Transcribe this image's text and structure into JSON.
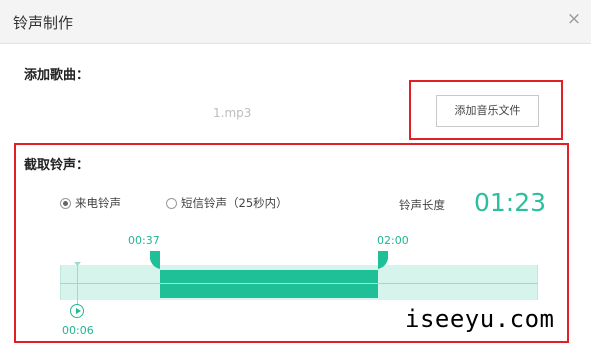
{
  "window": {
    "title": "铃声制作",
    "close_glyph": "×"
  },
  "add_song": {
    "label": "添加歌曲：",
    "filename": "1.mp3",
    "button_label": "添加音乐文件"
  },
  "clip": {
    "label": "截取铃声：",
    "radio_options": [
      {
        "label": "来电铃声",
        "checked": true
      },
      {
        "label": "短信铃声（25秒内）",
        "checked": false
      }
    ],
    "length_label": "铃声长度",
    "length_value": "01:23",
    "start_time": "00:37",
    "end_time": "02:00",
    "current_time": "00:06",
    "selection_fraction": {
      "start": 0.21,
      "end": 0.665
    },
    "accent_color": "#1fbf97"
  },
  "watermark": "iseeyu.com"
}
